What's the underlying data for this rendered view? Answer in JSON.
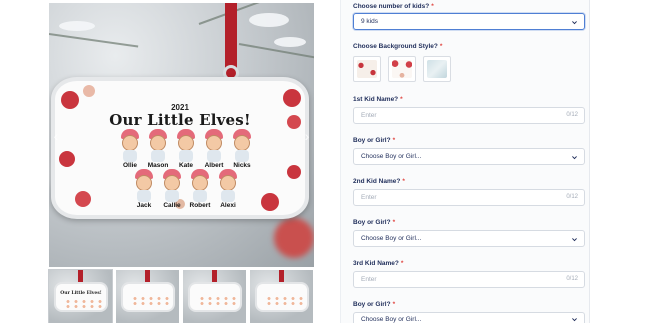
{
  "gallery": {
    "ornament": {
      "year": "2021",
      "title": "Our Little Elves!",
      "names_row1": [
        "Ollie",
        "Mason",
        "Kate",
        "Albert",
        "Nicks"
      ],
      "names_row2": [
        "Jack",
        "Callie",
        "Robert",
        "Alexi"
      ]
    },
    "thumbnails": [
      {
        "caption": "Our Little Elves!"
      },
      {
        "caption": ""
      },
      {
        "caption": ""
      },
      {
        "caption": ""
      }
    ]
  },
  "form": {
    "kids_count": {
      "label": "Choose number of kids?",
      "required_mark": "*",
      "selected": "9 kids"
    },
    "background": {
      "label": "Choose Background Style?",
      "required_mark": "*",
      "options": [
        "red-baubles-style",
        "red-floral-style",
        "winter-frost-style"
      ]
    },
    "kid1_name": {
      "label": "1st Kid Name?",
      "required_mark": "*",
      "placeholder": "Enter",
      "counter": "0/12"
    },
    "gender1": {
      "label": "Boy or Girl?",
      "required_mark": "*",
      "selected": "Choose Boy or Girl..."
    },
    "kid2_name": {
      "label": "2nd Kid Name?",
      "required_mark": "*",
      "placeholder": "Enter",
      "counter": "0/12"
    },
    "gender2": {
      "label": "Boy or Girl?",
      "required_mark": "*",
      "selected": "Choose Boy or Girl..."
    },
    "kid3_name": {
      "label": "3rd Kid Name?",
      "required_mark": "*",
      "placeholder": "Enter",
      "counter": "0/12"
    },
    "gender3": {
      "label": "Boy or Girl?",
      "required_mark": "*",
      "selected": "Choose Boy or Girl..."
    }
  },
  "colors": {
    "accent_border": "#4f7fd4",
    "required": "#e0443f",
    "label_text": "#1f2d5a",
    "ribbon": "#b3202a"
  },
  "icons": {
    "select_chevron": "chevron-down-icon",
    "gallery_prev": "chevron-left-icon",
    "gallery_next": "chevron-right-icon"
  }
}
